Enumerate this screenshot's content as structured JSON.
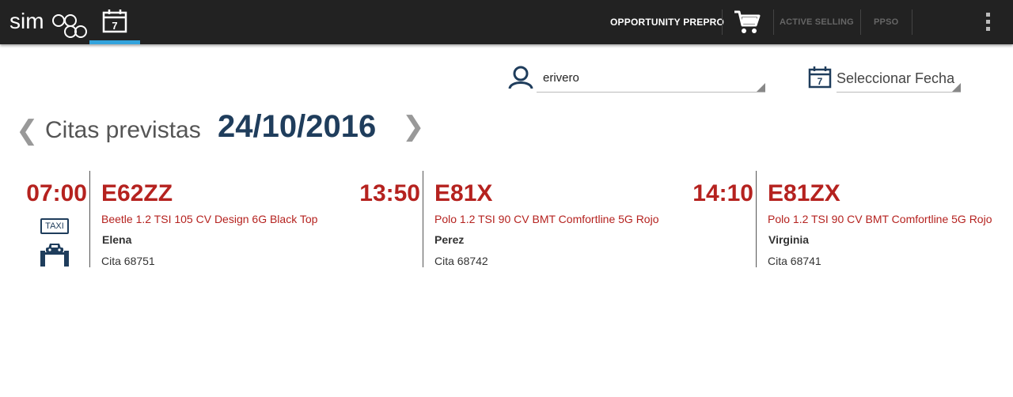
{
  "colors": {
    "accent": "#33a3dc",
    "brand_red": "#b5221f",
    "navy": "#1f3d5c",
    "topbar": "#222222"
  },
  "header": {
    "logo_text": "simago",
    "calendar_day": "7",
    "nav": {
      "opportunity": "OPPORTUNITY PREPRO",
      "active_selling": "ACTIVE SELLING",
      "ppso": "PPSO"
    }
  },
  "filters": {
    "user_value": "erivero",
    "date_placeholder": "Seleccionar Fecha",
    "date_icon_day": "7"
  },
  "agenda": {
    "prev": "❮",
    "next": "❯",
    "title": "Citas previstas",
    "date": "24/10/2016"
  },
  "appointments": [
    {
      "time": "07:00",
      "plate": "E62ZZ",
      "model": "Beetle 1.2 TSI 105 CV Design 6G Black Top",
      "client": "Elena",
      "cita": "Cita 68751",
      "badge": "TAXI"
    },
    {
      "time": "13:50",
      "plate": "E81X",
      "model": "Polo 1.2 TSI 90 CV BMT Comfortline 5G Rojo",
      "client": "Perez",
      "cita": "Cita 68742"
    },
    {
      "time": "14:10",
      "plate": "E81ZX",
      "model": "Polo 1.2 TSI 90 CV BMT Comfortline 5G Rojo",
      "client": "Virginia",
      "cita": "Cita 68741"
    }
  ]
}
